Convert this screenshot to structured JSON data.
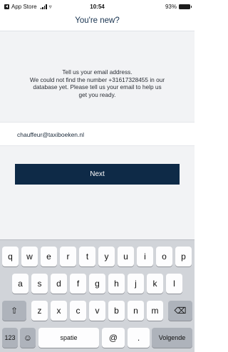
{
  "status_bar": {
    "back_app": "App Store",
    "signal": "ııl",
    "wifi": "▿",
    "time": "10:54",
    "battery": "93%"
  },
  "header": {
    "title": "You're new?"
  },
  "message": {
    "line1": "Tell us your email address.",
    "line2": "We could not find the number +31617328455 in our",
    "line3": "database yet. Please tell us your email to help us",
    "line4": "get you ready."
  },
  "email_field": {
    "value": "chauffeur@taxiboeken.nl"
  },
  "next_button": {
    "label": "Next"
  },
  "keyboard": {
    "row1": [
      "q",
      "w",
      "e",
      "r",
      "t",
      "y",
      "u",
      "i",
      "o",
      "p"
    ],
    "row2": [
      "a",
      "s",
      "d",
      "f",
      "g",
      "h",
      "j",
      "k",
      "l"
    ],
    "row3": [
      "z",
      "x",
      "c",
      "v",
      "b",
      "n",
      "m"
    ],
    "shift": "⇧",
    "backspace": "⌫",
    "numbers": "123",
    "emoji": "☺",
    "space": "spatie",
    "at": "@",
    "dot": ".",
    "return": "Volgende"
  }
}
